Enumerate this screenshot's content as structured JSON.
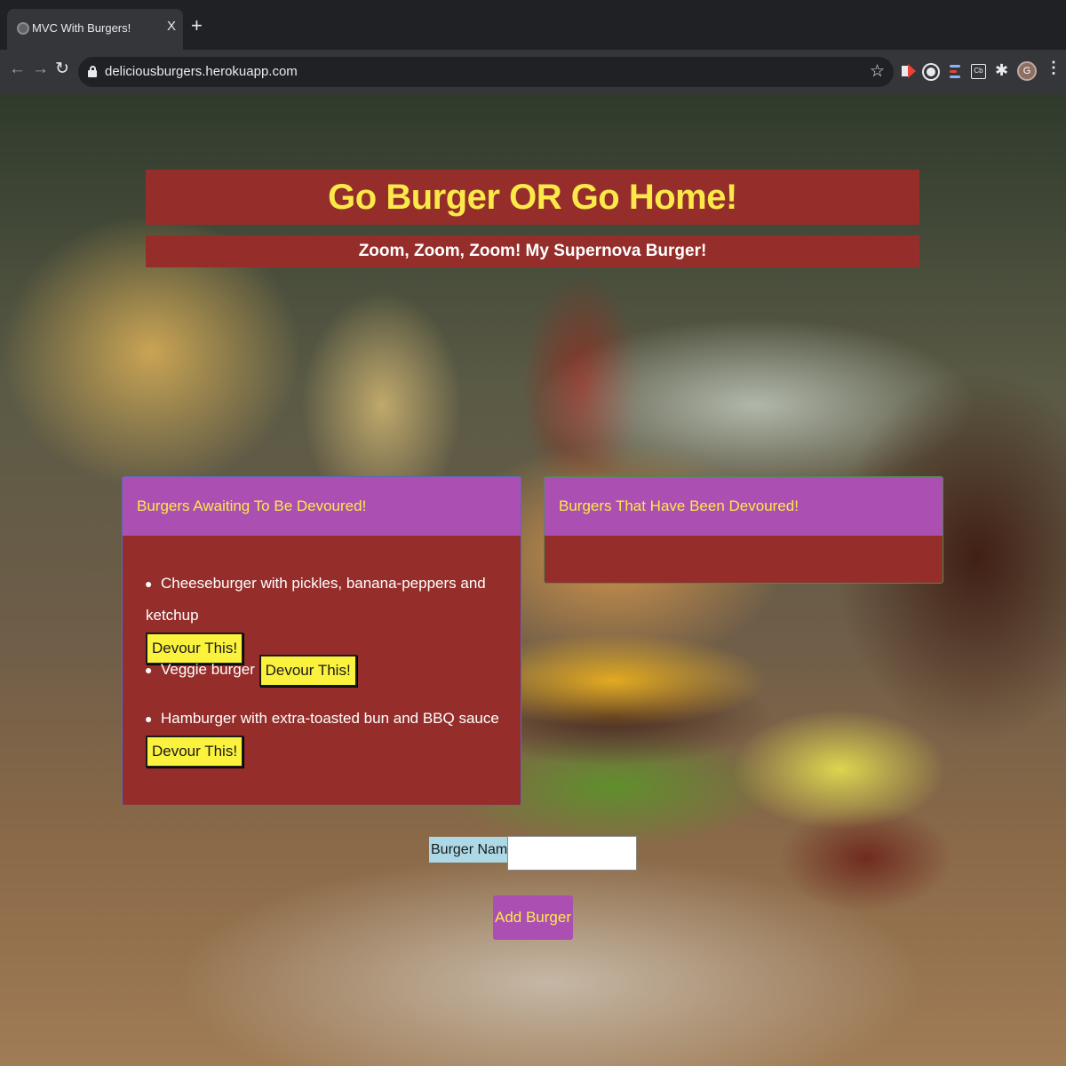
{
  "browser": {
    "tab_title": "MVC With Burgers!",
    "tab_close": "X",
    "new_tab": "+",
    "url": "deliciousburgers.herokuapp.com",
    "profile_initial": "G",
    "ext_icon_label": "Cb",
    "icons": [
      "back-icon",
      "forward-icon",
      "reload-icon",
      "lock-icon",
      "star-icon",
      "puzzle-icon",
      "menu-icon"
    ]
  },
  "header": {
    "title": "Go Burger OR Go Home!",
    "subtitle": "Zoom, Zoom, Zoom! My Supernova Burger!"
  },
  "awaiting": {
    "heading": "Burgers Awaiting To Be Devoured!",
    "items": [
      {
        "name": "Cheeseburger with pickles, banana-peppers and ketchup",
        "button": "Devour This!"
      },
      {
        "name": "Veggie burger",
        "button": "Devour This!"
      },
      {
        "name": "Hamburger with extra-toasted bun and BBQ sauce",
        "button": "Devour This!"
      }
    ]
  },
  "devoured": {
    "heading": "Burgers That Have Been Devoured!",
    "items": []
  },
  "form": {
    "label": "Burger Name:",
    "input_value": "",
    "submit_label": "Add Burger"
  },
  "colors": {
    "panel_red": "#952e2a",
    "card_header_purple": "#ac4fb3",
    "heading_yellow": "#fbe94a",
    "button_yellow": "#fbf23e",
    "label_blue": "#add8e6"
  }
}
